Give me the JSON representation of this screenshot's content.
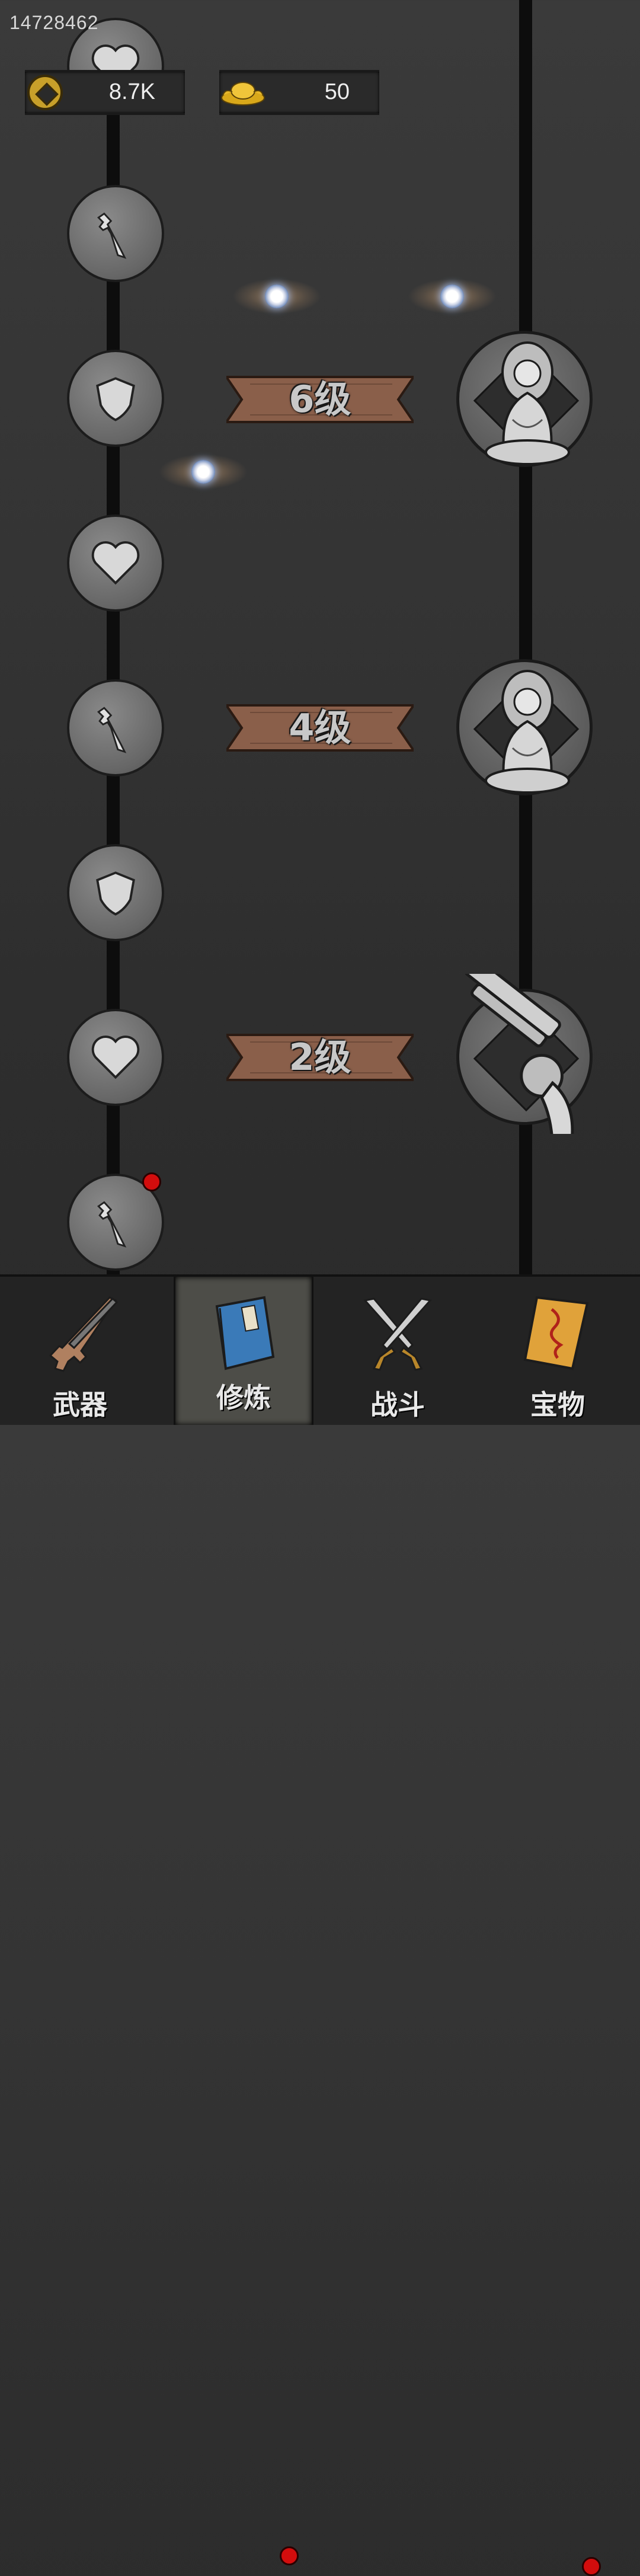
{
  "player_id": "14728462",
  "currency": {
    "coins": "8.7K",
    "ingots": "50"
  },
  "levels": [
    {
      "label": "6级"
    },
    {
      "label": "4级"
    },
    {
      "label": "2级"
    }
  ],
  "nav": {
    "tabs": [
      {
        "label": "武器",
        "icon": "rifle-icon",
        "active": false,
        "badge": false
      },
      {
        "label": "修炼",
        "icon": "book-icon",
        "active": true,
        "badge": true
      },
      {
        "label": "战斗",
        "icon": "crossed-swords-icon",
        "active": false,
        "badge": false
      },
      {
        "label": "宝物",
        "icon": "talisman-icon",
        "active": false,
        "badge": true
      }
    ]
  },
  "colors": {
    "background": "#343434",
    "banner": "#8a5f4a",
    "badge": "#d30d0d",
    "coin": "#c8a02a"
  }
}
